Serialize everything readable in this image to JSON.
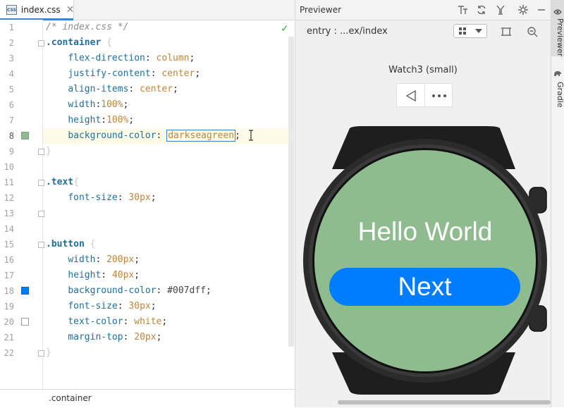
{
  "editor": {
    "tab": {
      "icon_text": "CSS",
      "label": "index.css",
      "close": "✕"
    },
    "lines": [
      {
        "n": "1"
      },
      {
        "n": "2"
      },
      {
        "n": "3"
      },
      {
        "n": "4"
      },
      {
        "n": "5"
      },
      {
        "n": "6"
      },
      {
        "n": "7"
      },
      {
        "n": "8"
      },
      {
        "n": "9"
      },
      {
        "n": "10"
      },
      {
        "n": "11"
      },
      {
        "n": "12"
      },
      {
        "n": "13"
      },
      {
        "n": "14"
      },
      {
        "n": "15"
      },
      {
        "n": "16"
      },
      {
        "n": "17"
      },
      {
        "n": "18"
      },
      {
        "n": "19"
      },
      {
        "n": "20"
      },
      {
        "n": "21"
      },
      {
        "n": "22"
      }
    ],
    "code": {
      "comment": "/* index.css */",
      "sel_container": ".container",
      "sel_text": ".text",
      "sel_button": ".button",
      "open": "{",
      "close": "}",
      "p_flex_direction": "flex-direction",
      "v_column": "column",
      "p_justify_content": "justify-content",
      "v_center": "center",
      "p_align_items": "align-items",
      "p_width": "width",
      "v_100": "100%",
      "p_height": "height",
      "p_background_color": "background-color",
      "v_darkseagreen": "darkseagreen",
      "p_font_size": "font-size",
      "v_30px": "30px",
      "v_200px": "200px",
      "v_40px": "40px",
      "v_007dff": "#007dff",
      "p_text_color": "text-color",
      "v_white": "white",
      "p_margin_top": "margin-top",
      "v_20px": "20px"
    },
    "colors": {
      "swatch_line8": "#8fbc8f",
      "swatch_line18": "#007dff",
      "swatch_line20": "#ffffff"
    },
    "breadcrumb": ".container"
  },
  "previewer": {
    "title": "Previewer",
    "entry": "entry : ...ex/index",
    "device": "Watch3 (small)",
    "screen": {
      "hello": "Hello World",
      "button": "Next"
    },
    "colors": {
      "screen_bg": "#8fbc8f",
      "button_bg": "#007dff"
    }
  },
  "side_tabs": {
    "previewer": "Previewer",
    "gradle": "Gradle"
  }
}
